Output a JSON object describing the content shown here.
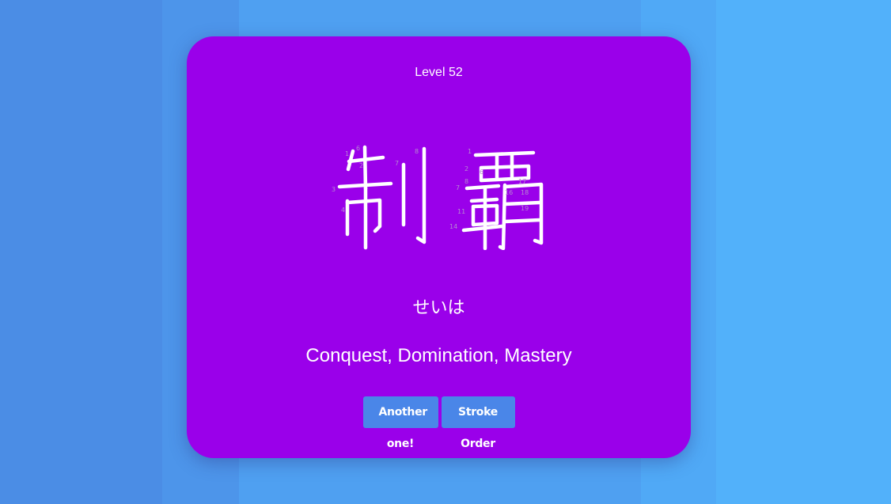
{
  "card": {
    "level": "Level 52",
    "kanji": "制覇",
    "reading": "せいは",
    "meaning": "Conquest, Domination, Mastery",
    "buttons": {
      "another": "Another one!",
      "stroke_order": "Stroke Order"
    },
    "stroke_numbers": {
      "first_char": [
        "1",
        "6",
        "2",
        "8",
        "7",
        "3",
        "4"
      ],
      "second_char": [
        "1",
        "2",
        "6",
        "8",
        "7",
        "17",
        "16",
        "18",
        "11",
        "19",
        "14"
      ]
    }
  },
  "colors": {
    "card_background": "#9a00ea",
    "button_background": "#4a86e8",
    "text": "#ffffff"
  }
}
